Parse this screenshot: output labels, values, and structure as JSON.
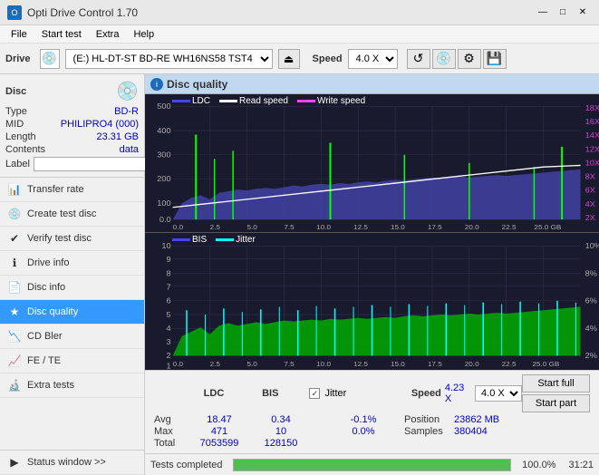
{
  "titlebar": {
    "title": "Opti Drive Control 1.70",
    "icon": "O",
    "controls": [
      "—",
      "□",
      "✕"
    ]
  },
  "menubar": {
    "items": [
      "File",
      "Start test",
      "Extra",
      "Help"
    ]
  },
  "drivebar": {
    "label": "Drive",
    "drive_display": "(E:)  HL-DT-ST BD-RE  WH16NS58 TST4",
    "speed_label": "Speed",
    "speed_value": "4.0 X"
  },
  "disc": {
    "title": "Disc",
    "type_label": "Type",
    "type_value": "BD-R",
    "mid_label": "MID",
    "mid_value": "PHILIPRO4 (000)",
    "length_label": "Length",
    "length_value": "23.31 GB",
    "contents_label": "Contents",
    "contents_value": "data",
    "label_label": "Label",
    "label_value": ""
  },
  "nav": {
    "items": [
      {
        "id": "transfer-rate",
        "label": "Transfer rate",
        "icon": "📊"
      },
      {
        "id": "create-test-disc",
        "label": "Create test disc",
        "icon": "💿"
      },
      {
        "id": "verify-test-disc",
        "label": "Verify test disc",
        "icon": "✔"
      },
      {
        "id": "drive-info",
        "label": "Drive info",
        "icon": "ℹ"
      },
      {
        "id": "disc-info",
        "label": "Disc info",
        "icon": "📄"
      },
      {
        "id": "disc-quality",
        "label": "Disc quality",
        "icon": "★",
        "active": true
      },
      {
        "id": "cd-bler",
        "label": "CD Bler",
        "icon": "📉"
      },
      {
        "id": "fe-te",
        "label": "FE / TE",
        "icon": "📈"
      },
      {
        "id": "extra-tests",
        "label": "Extra tests",
        "icon": "🔬"
      }
    ]
  },
  "status_window": {
    "label": "Status window >>"
  },
  "disc_quality": {
    "title": "Disc quality",
    "legend": {
      "ldc": "LDC",
      "read_speed": "Read speed",
      "write_speed": "Write speed",
      "bis": "BIS",
      "jitter": "Jitter"
    }
  },
  "stats": {
    "columns": [
      "LDC",
      "BIS",
      "",
      "Jitter",
      "Speed",
      ""
    ],
    "rows": [
      {
        "label": "Avg",
        "ldc": "18.47",
        "bis": "0.34",
        "jitter": "-0.1%",
        "speed_label": "Position",
        "speed_value": "23862 MB"
      },
      {
        "label": "Max",
        "ldc": "471",
        "bis": "10",
        "jitter": "0.0%",
        "speed_label": "Samples",
        "speed_value": "380404"
      },
      {
        "label": "Total",
        "ldc": "7053599",
        "bis": "128150",
        "jitter": ""
      }
    ],
    "jitter_checked": true,
    "jitter_label": "Jitter",
    "speed_display": "4.23 X",
    "speed_select": "4.0 X",
    "btn_start_full": "Start full",
    "btn_start_part": "Start part"
  },
  "bottom_status": {
    "text": "Tests completed",
    "progress": 100.0,
    "time": "31:21"
  },
  "chart_top": {
    "y_left": [
      "500",
      "400",
      "300",
      "200",
      "100",
      "0.0"
    ],
    "y_right": [
      "18X",
      "16X",
      "14X",
      "12X",
      "10X",
      "8X",
      "6X",
      "4X",
      "2X"
    ],
    "x_labels": [
      "0.0",
      "2.5",
      "5.0",
      "7.5",
      "10.0",
      "12.5",
      "15.0",
      "17.5",
      "20.0",
      "22.5",
      "25.0 GB"
    ]
  },
  "chart_bottom": {
    "y_left": [
      "10",
      "9",
      "8",
      "7",
      "6",
      "5",
      "4",
      "3",
      "2",
      "1"
    ],
    "y_right": [
      "10%",
      "8%",
      "6%",
      "4%",
      "2%"
    ],
    "x_labels": [
      "0.0",
      "2.5",
      "5.0",
      "7.5",
      "10.0",
      "12.5",
      "15.0",
      "17.5",
      "20.0",
      "22.5",
      "25.0 GB"
    ]
  }
}
